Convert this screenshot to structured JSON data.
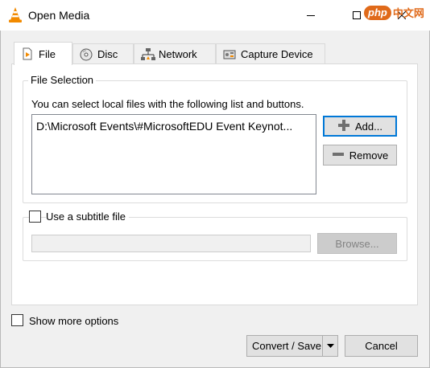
{
  "window": {
    "title": "Open Media"
  },
  "watermark": {
    "logo": "php",
    "text": "中文网"
  },
  "tabs": [
    {
      "label": "File",
      "icon": "file-play-icon",
      "active": true
    },
    {
      "label": "Disc",
      "icon": "disc-icon",
      "active": false
    },
    {
      "label": "Network",
      "icon": "network-icon",
      "active": false
    },
    {
      "label": "Capture Device",
      "icon": "capture-device-icon",
      "active": false
    }
  ],
  "file_selection": {
    "legend": "File Selection",
    "description": "You can select local files with the following list and buttons.",
    "files": [
      "D:\\Microsoft Events\\#MicrosoftEDU Event Keynot..."
    ],
    "add_label": "Add...",
    "remove_label": "Remove"
  },
  "subtitle": {
    "checkbox_label": "Use a subtitle file",
    "checked": false,
    "value": "",
    "browse_label": "Browse..."
  },
  "footer": {
    "show_more_label": "Show more options",
    "show_more_checked": false,
    "convert_label": "Convert / Save",
    "cancel_label": "Cancel"
  },
  "colors": {
    "accent": "#0078d7",
    "vlc_orange": "#f28a00"
  }
}
